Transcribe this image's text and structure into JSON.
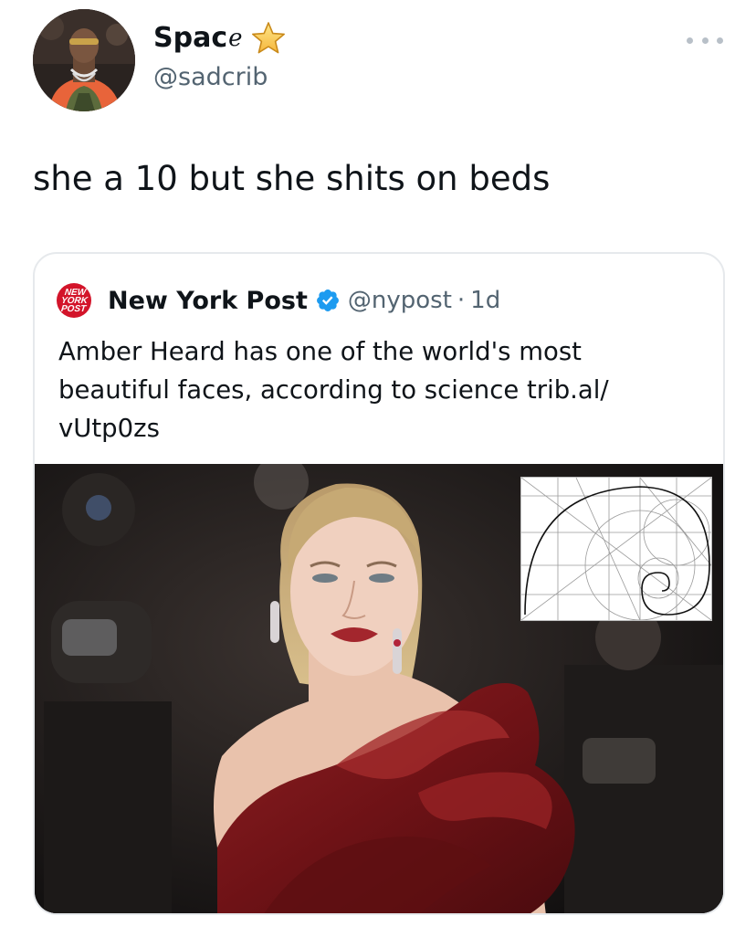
{
  "tweet": {
    "author": {
      "display_name": "Spac",
      "display_name_suffix": "e",
      "badge_icon": "star-icon",
      "handle": "@sadcrib",
      "avatar_icon": "avatar-photo"
    },
    "more_icon": "more-dots-icon",
    "text": "she a 10 but she shits on beds",
    "quote": {
      "logo_text": [
        "NEW",
        "YORK",
        "POST"
      ],
      "logo_color": "#d3142a",
      "author_name": "New York Post",
      "verified_icon": "verified-badge-icon",
      "verified_color": "#1d9bf0",
      "handle": "@nypost",
      "separator": "·",
      "time": "1d",
      "text_lines": [
        "Amber Heard has one of the world's most",
        "beautiful faces, according to science trib.al/",
        "vUtp0zs"
      ],
      "media_icon": "photo-red-carpet-with-golden-ratio-overlay"
    }
  }
}
